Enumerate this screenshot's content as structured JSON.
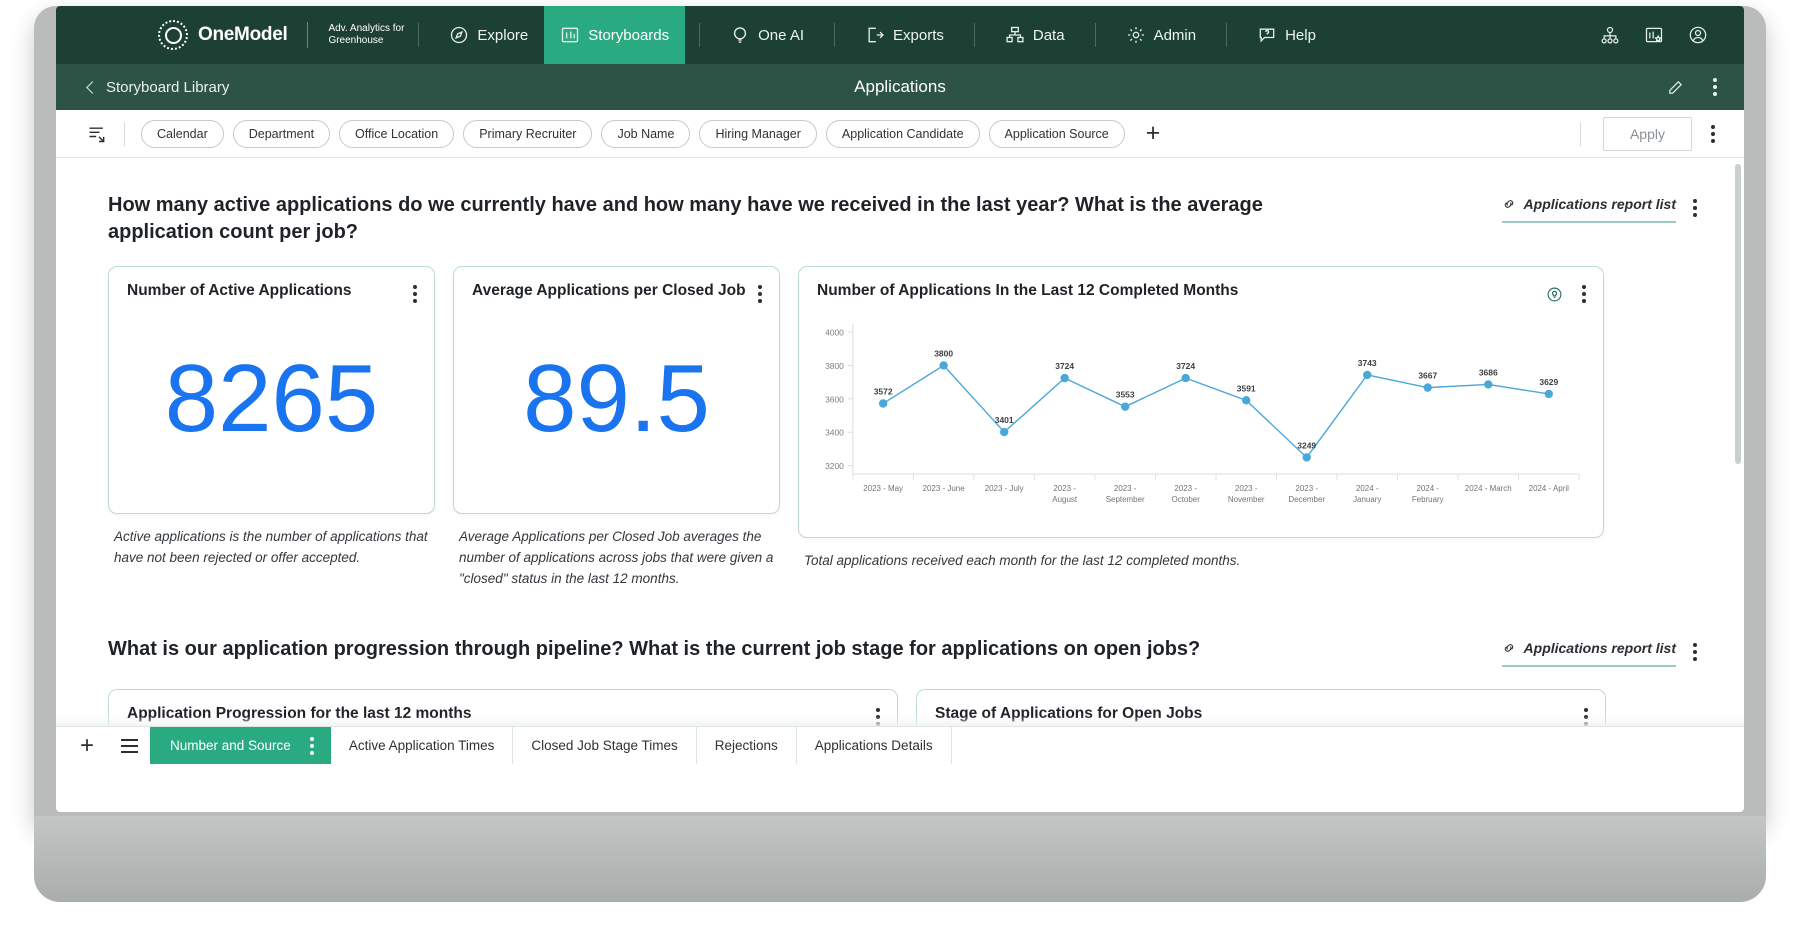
{
  "topnav": {
    "brand_name": "OneModel",
    "brand_sub_line1": "Adv. Analytics for",
    "brand_sub_line2": "Greenhouse",
    "items": [
      {
        "label": "Explore",
        "icon": "compass-icon",
        "active": false
      },
      {
        "label": "Storyboards",
        "icon": "storyboard-icon",
        "active": true
      },
      {
        "label": "One AI",
        "icon": "lightbulb-icon",
        "active": false
      },
      {
        "label": "Exports",
        "icon": "export-icon",
        "active": false
      },
      {
        "label": "Data",
        "icon": "sitemap-icon",
        "active": false
      },
      {
        "label": "Admin",
        "icon": "gear-icon",
        "active": false
      },
      {
        "label": "Help",
        "icon": "help-chat-icon",
        "active": false
      }
    ],
    "right_icons": [
      "org-chart-icon",
      "favorite-dashboard-icon",
      "user-account-icon"
    ]
  },
  "subheader": {
    "back_label": "Storyboard Library",
    "title": "Applications",
    "edit_icon": "pencil-icon",
    "menu_icon": "kebab-menu-icon"
  },
  "filterbar": {
    "filter_icon": "filter-list-icon",
    "chips": [
      "Calendar",
      "Department",
      "Office Location",
      "Primary Recruiter",
      "Job Name",
      "Hiring Manager",
      "Application Candidate",
      "Application Source"
    ],
    "add_filter_label": "+",
    "apply_label": "Apply"
  },
  "sections": [
    {
      "question": "How many active applications do we currently have and how many have we received in the last year? What is the average application count per job?",
      "report_link": "Applications report list"
    },
    {
      "question": "What is our application progression through pipeline? What is the current job stage for applications on open jobs?",
      "report_link": "Applications report list"
    }
  ],
  "kpi_cards": [
    {
      "title": "Number of Active Applications",
      "value": "8265",
      "caption": "Active applications is the number of applications that have not been rejected or offer accepted."
    },
    {
      "title": "Average Applications per Closed Job",
      "value": "89.5",
      "caption": "Average Applications per Closed Job averages the number of applications across jobs that were given a \"closed\" status in the last 12 months."
    }
  ],
  "chart_card": {
    "title": "Number of Applications In the Last 12 Completed Months",
    "caption": "Total applications received each month for the last 12 completed months.",
    "insight_icon": "lightbulb-icon",
    "menu_icon": "kebab-menu-icon"
  },
  "chart_data": {
    "type": "line",
    "title": "Number of Applications In the Last 12 Completed Months",
    "xlabel": "",
    "ylabel": "",
    "categories": [
      "2023 - May",
      "2023 - June",
      "2023 - July",
      "2023 - August",
      "2023 - September",
      "2023 - October",
      "2023 - November",
      "2023 - December",
      "2024 - January",
      "2024 - February",
      "2024 - March",
      "2024 - April"
    ],
    "values": [
      3572,
      3800,
      3401,
      3724,
      3553,
      3724,
      3591,
      3249,
      3743,
      3667,
      3686,
      3629
    ],
    "yticks": [
      3200,
      3400,
      3600,
      3800,
      4000
    ],
    "ylim": [
      3150,
      4000
    ],
    "grid": false,
    "legend": "none",
    "series_color": "#4aa8d8",
    "point_labels": true
  },
  "lower_panels": [
    {
      "title": "Application Progression for the last 12 months"
    },
    {
      "title": "Stage of Applications for Open Jobs"
    }
  ],
  "tabbar": {
    "add_icon": "plus-icon",
    "menu_icon": "hamburger-icon",
    "active_tab": "Number and Source",
    "tabs": [
      "Active Application Times",
      "Closed Job Stage Times",
      "Rejections",
      "Applications Details"
    ]
  },
  "colors": {
    "nav_dark": "#1d4034",
    "nav_sub": "#2c5346",
    "accent_green": "#2aaa80",
    "kpi_blue": "#1a73ef",
    "chart_blue": "#4aa8d8"
  }
}
